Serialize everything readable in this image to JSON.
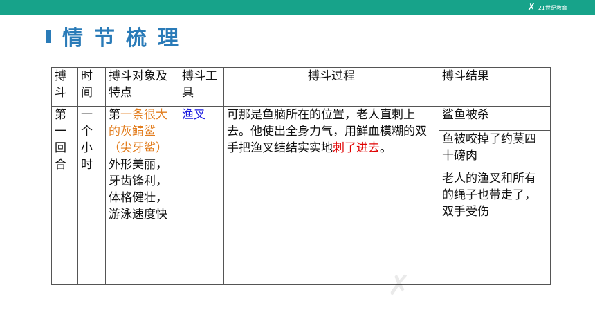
{
  "header": {
    "logo_text": "21世纪教育"
  },
  "page": {
    "title": "情节梳理"
  },
  "table": {
    "headers": [
      "搏斗",
      "时间",
      "搏斗对象及特点",
      "搏斗工具",
      "搏斗过程",
      "搏斗结果"
    ],
    "row": {
      "round": "第一回合",
      "time": "一个小时",
      "target_pre": "第",
      "target_highlight": "一条很大的灰鲭鲨（尖牙鲨）",
      "target_post": "外形美丽，牙齿锋利，体格健壮，游泳速度快",
      "tool": "渔叉",
      "process_main": "可那是鱼脑所在的位置，老人直刺上去。他使出全身力气，用鲜血模糊的双手把渔叉结结实实地",
      "process_highlight": "刺了进去",
      "process_end": "。",
      "results": [
        "鲨鱼被杀",
        "鱼被咬掉了约莫四十磅肉",
        "老人的渔叉和所有的绳子也带走了，双手受伤"
      ]
    }
  },
  "colors": {
    "accent": "#17a38a",
    "title": "#2a7bb8",
    "orange": "#e27d1e",
    "blue": "#1a1ae0",
    "red": "#e00000"
  }
}
